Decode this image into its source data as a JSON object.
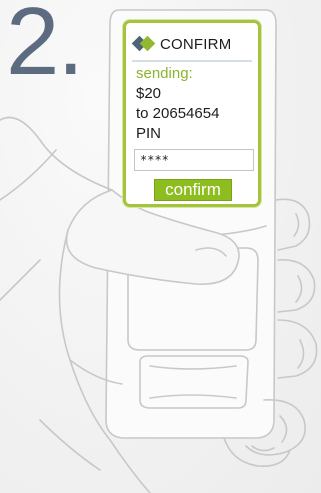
{
  "step": {
    "number": "2."
  },
  "screen": {
    "title": "CONFIRM",
    "sending_label": "sending:",
    "amount": "$20",
    "recipient": "to 20654654",
    "pin_label": "PIN",
    "pin_value": "****",
    "confirm_label": "confirm"
  },
  "icons": {
    "logo": "double-diamond-logo-icon"
  },
  "colors": {
    "accent_green": "#8ebd1f",
    "screen_border": "#a3c43c",
    "step_number": "#5d6b80",
    "logo_dark": "#4d6378"
  }
}
